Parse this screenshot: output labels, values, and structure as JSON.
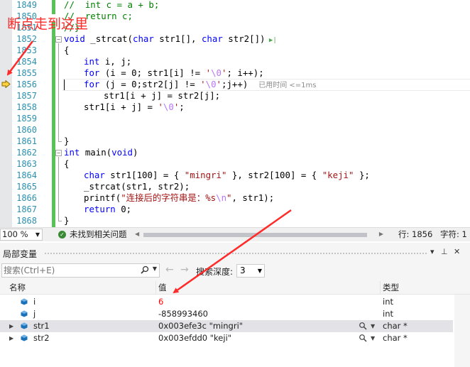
{
  "annotation": {
    "breakpoint_note": "断点走到这里",
    "color": "#ff2a2a"
  },
  "editor": {
    "lines": [
      {
        "n": "1849"
      },
      {
        "n": "1850"
      },
      {
        "n": "1851"
      },
      {
        "n": "1852"
      },
      {
        "n": "1853"
      },
      {
        "n": "1854"
      },
      {
        "n": "1855"
      },
      {
        "n": "1856"
      },
      {
        "n": "1857"
      },
      {
        "n": "1858"
      },
      {
        "n": "1859"
      },
      {
        "n": "1860"
      },
      {
        "n": "1861"
      },
      {
        "n": "1862"
      },
      {
        "n": "1863"
      },
      {
        "n": "1864"
      },
      {
        "n": "1865"
      },
      {
        "n": "1866"
      },
      {
        "n": "1867"
      },
      {
        "n": "1868"
      }
    ],
    "code": {
      "l1849_comment": "//  int c = a + b;",
      "l1850_comment": "//  return c;",
      "l1851_comment": "//}",
      "l1852_kw": "void",
      "l1852_rest": " _strcat(",
      "l1852_kw2": "char",
      "l1852_rest2": " str1[], ",
      "l1852_kw3": "char",
      "l1852_rest3": " str2[])",
      "l1853": "{",
      "l1854_kw": "int",
      "l1854_rest": " i, j;",
      "l1855_kw": "for",
      "l1855_a": " (i = 0; str1[i] != ",
      "l1855_q1": "'",
      "l1855_esc": "\\0",
      "l1855_q2": "'",
      "l1855_b": "; i++);",
      "l1856_kw": "for",
      "l1856_a": " (j = 0;str2[j] != ",
      "l1856_q1": "'",
      "l1856_esc": "\\0",
      "l1856_q2": "'",
      "l1856_b": ";j++)",
      "l1856_hint": "已用时间 <=1ms",
      "l1857": "str1[i + j] = str2[j];",
      "l1858_a": "str1[i + j] = ",
      "l1858_q1": "'",
      "l1858_esc": "\\0",
      "l1858_q2": "'",
      "l1858_b": ";",
      "l1861": "}",
      "l1862_kw": "int",
      "l1862_rest": " main(",
      "l1862_kw2": "void",
      "l1862_rest2": ")",
      "l1863": "{",
      "l1864_kw": "char",
      "l1864_a": " str1[100] = { ",
      "l1864_s1": "\"mingri\"",
      "l1864_b": " }, str2[100] = { ",
      "l1864_s2": "\"keji\"",
      "l1864_c": " };",
      "l1865": "_strcat(str1, str2);",
      "l1866_a": "printf(",
      "l1866_s": "\"连接后的字符串是：%s",
      "l1866_esc": "\\n",
      "l1866_s2": "\"",
      "l1866_b": ", str1);",
      "l1867_kw": "return",
      "l1867_rest": " 0;",
      "l1868": "}"
    }
  },
  "status": {
    "zoom": "100 %",
    "issues": "未找到相关问题",
    "line": "行: 1856",
    "char": "字符: 1"
  },
  "locals": {
    "title": "局部变量",
    "search_placeholder": "搜索(Ctrl+E)",
    "depth_label": "搜索深度:",
    "depth_value": "3",
    "columns": {
      "name": "名称",
      "value": "值",
      "type": "类型"
    },
    "rows": [
      {
        "name": "i",
        "value": "6",
        "type": "int"
      },
      {
        "name": "j",
        "value": "-858993460",
        "type": "int"
      },
      {
        "name": "str1",
        "value": "0x003efe3c \"mingri\"",
        "type": "char *"
      },
      {
        "name": "str2",
        "value": "0x003efdd0 \"keji\"",
        "type": "char *"
      }
    ]
  }
}
